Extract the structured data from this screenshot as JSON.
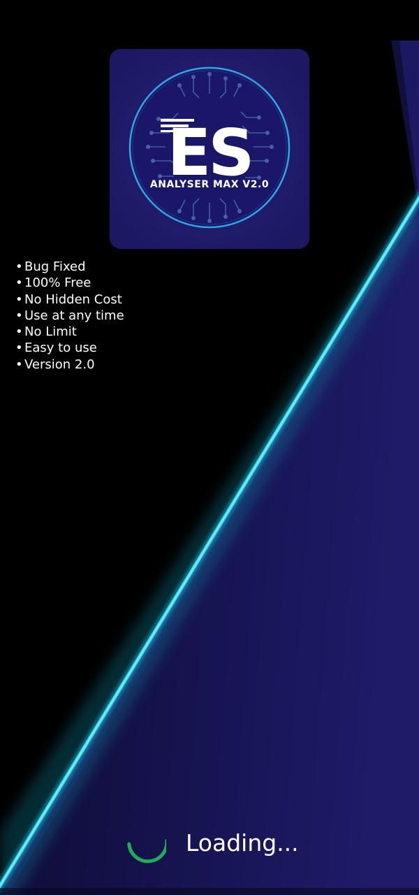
{
  "app": {
    "logo_letters": "ES",
    "logo_caption": "ANALYSER MAX V2.0"
  },
  "features": [
    {
      "bullet": "•",
      "text": "Bug Fixed"
    },
    {
      "bullet": "•",
      "text": "100% Free"
    },
    {
      "bullet": "•",
      "text": "No Hidden Cost"
    },
    {
      "bullet": "•",
      "text": "Use at any time"
    },
    {
      "bullet": "•",
      "text": "No Limit"
    },
    {
      "bullet": "•",
      "text": "Easy to use"
    },
    {
      "bullet": "•",
      "text": "Version 2.0"
    }
  ],
  "loading": {
    "text": "Loading...",
    "spinner_icon": "loading-spinner-icon"
  },
  "colors": {
    "background_dark": "#000000",
    "background_navy": "#1b1860",
    "neon_line": "#2ad6f0",
    "logo_tile": "#1e1a63",
    "spinner": "#1fae55",
    "text": "#ffffff"
  }
}
